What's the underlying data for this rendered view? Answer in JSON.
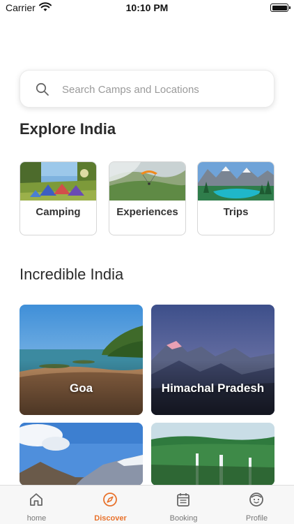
{
  "status_bar": {
    "carrier": "Carrier",
    "time": "10:10 PM",
    "battery_level": 1.0
  },
  "search": {
    "placeholder": "Search Camps and Locations",
    "value": ""
  },
  "explore": {
    "title": "Explore India",
    "categories": [
      {
        "label": "Camping"
      },
      {
        "label": "Experiences"
      },
      {
        "label": "Trips"
      }
    ]
  },
  "incredible": {
    "title": "Incredible India",
    "destinations": [
      {
        "label": "Goa"
      },
      {
        "label": "Himachal Pradesh"
      },
      {
        "label": ""
      },
      {
        "label": ""
      }
    ]
  },
  "tab_bar": {
    "active_color": "#e8722c",
    "items": [
      {
        "label": "home",
        "icon": "home-icon",
        "active": false
      },
      {
        "label": "Discover",
        "icon": "compass-icon",
        "active": true
      },
      {
        "label": "Booking",
        "icon": "calendar-icon",
        "active": false
      },
      {
        "label": "Profile",
        "icon": "face-icon",
        "active": false
      }
    ]
  }
}
